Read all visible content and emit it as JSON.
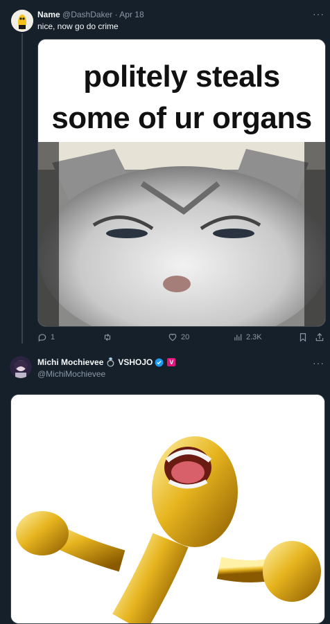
{
  "tweet1": {
    "display_name": "Name",
    "handle": "@DashDaker",
    "separator": "·",
    "date": "Apr 18",
    "text": "nice, now go do crime",
    "image_caption_line1": "politely steals",
    "image_caption_line2": "some of ur organs",
    "actions": {
      "replies": "1",
      "likes": "20",
      "views": "2.3K"
    }
  },
  "tweet2": {
    "display_name": "Michi Mochievee",
    "ring_emoji": "💍",
    "org": "VSHOJO",
    "affiliate_badge": "V",
    "handle": "@MichiMochievee"
  },
  "colors": {
    "background": "#15202b",
    "muted": "#8b98a5",
    "verified": "#1d9bf0",
    "affiliate": "#e0177d"
  }
}
